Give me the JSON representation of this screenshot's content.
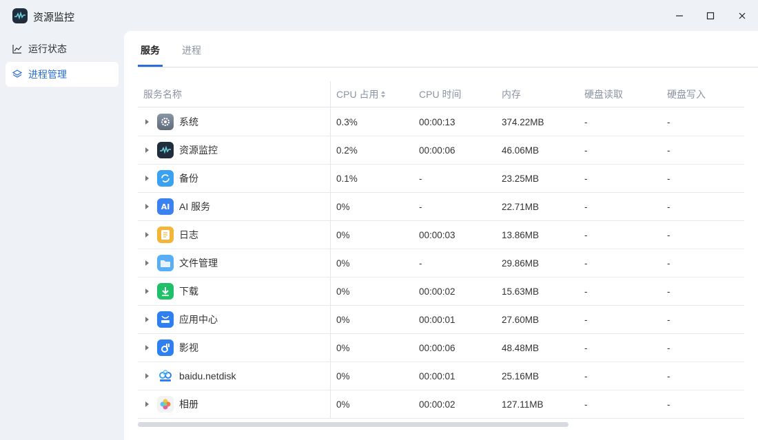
{
  "app": {
    "title": "资源监控"
  },
  "sidebar": {
    "items": [
      {
        "label": "运行状态",
        "icon": "line-chart-icon",
        "active": false
      },
      {
        "label": "进程管理",
        "icon": "layers-icon",
        "active": true
      }
    ]
  },
  "tabs": [
    {
      "label": "服务",
      "active": true
    },
    {
      "label": "进程",
      "active": false
    }
  ],
  "table": {
    "columns": [
      "服务名称",
      "CPU 占用",
      "CPU 时间",
      "内存",
      "硬盘读取",
      "硬盘写入"
    ],
    "rows": [
      {
        "name": "系统",
        "icon": "gear-icon",
        "cpu": "0.3%",
        "cpu_time": "00:00:13",
        "memory": "374.22MB",
        "disk_read": "-",
        "disk_write": "-"
      },
      {
        "name": "资源监控",
        "icon": "resource-monitor-icon",
        "cpu": "0.2%",
        "cpu_time": "00:00:06",
        "memory": "46.06MB",
        "disk_read": "-",
        "disk_write": "-"
      },
      {
        "name": "备份",
        "icon": "backup-icon",
        "cpu": "0.1%",
        "cpu_time": "-",
        "memory": "23.25MB",
        "disk_read": "-",
        "disk_write": "-"
      },
      {
        "name": "AI 服务",
        "icon": "ai-icon",
        "icon_text": "AI",
        "cpu": "0%",
        "cpu_time": "-",
        "memory": "22.71MB",
        "disk_read": "-",
        "disk_write": "-"
      },
      {
        "name": "日志",
        "icon": "log-icon",
        "cpu": "0%",
        "cpu_time": "00:00:03",
        "memory": "13.86MB",
        "disk_read": "-",
        "disk_write": "-"
      },
      {
        "name": "文件管理",
        "icon": "folder-icon",
        "cpu": "0%",
        "cpu_time": "-",
        "memory": "29.86MB",
        "disk_read": "-",
        "disk_write": "-"
      },
      {
        "name": "下载",
        "icon": "download-icon",
        "cpu": "0%",
        "cpu_time": "00:00:02",
        "memory": "15.63MB",
        "disk_read": "-",
        "disk_write": "-"
      },
      {
        "name": "应用中心",
        "icon": "app-center-icon",
        "cpu": "0%",
        "cpu_time": "00:00:01",
        "memory": "27.60MB",
        "disk_read": "-",
        "disk_write": "-"
      },
      {
        "name": "影视",
        "icon": "video-icon",
        "cpu": "0%",
        "cpu_time": "00:00:06",
        "memory": "48.48MB",
        "disk_read": "-",
        "disk_write": "-"
      },
      {
        "name": "baidu.netdisk",
        "icon": "baidu-netdisk-icon",
        "cpu": "0%",
        "cpu_time": "00:00:01",
        "memory": "25.16MB",
        "disk_read": "-",
        "disk_write": "-"
      },
      {
        "name": "相册",
        "icon": "photos-icon",
        "cpu": "0%",
        "cpu_time": "00:00:02",
        "memory": "127.11MB",
        "disk_read": "-",
        "disk_write": "-"
      }
    ]
  },
  "colors": {
    "accent": "#2b6fd6",
    "sidebar_bg": "#eef1f6",
    "header_text": "#8a94a3"
  }
}
